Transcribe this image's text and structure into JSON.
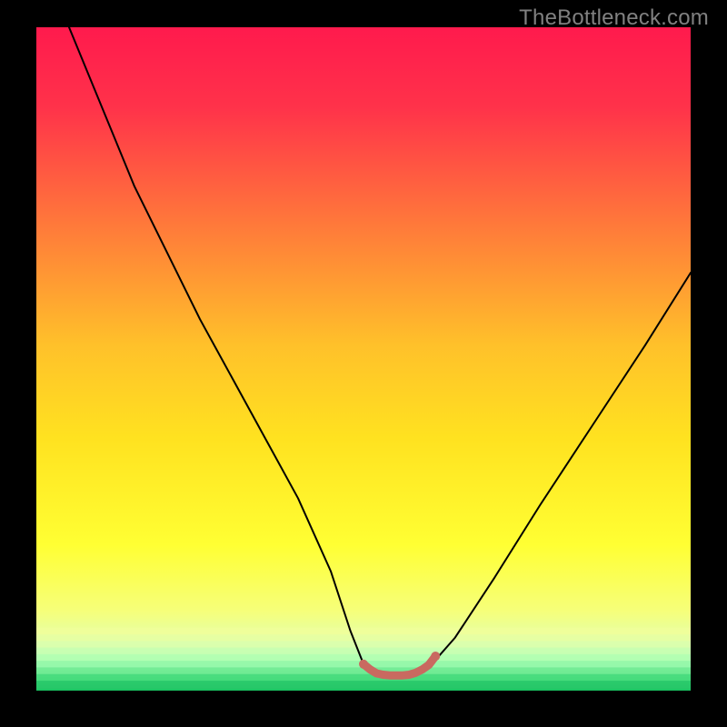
{
  "watermark": "TheBottleneck.com",
  "chart_data": {
    "type": "line",
    "title": "",
    "xlabel": "",
    "ylabel": "",
    "xlim": [
      0,
      100
    ],
    "ylim": [
      0,
      100
    ],
    "grid": false,
    "legend": false,
    "gradient_stops": [
      {
        "offset": 0.0,
        "color": "#ff1a4d"
      },
      {
        "offset": 0.12,
        "color": "#ff324a"
      },
      {
        "offset": 0.3,
        "color": "#ff7a3a"
      },
      {
        "offset": 0.48,
        "color": "#ffc12a"
      },
      {
        "offset": 0.62,
        "color": "#ffe220"
      },
      {
        "offset": 0.78,
        "color": "#ffff33"
      },
      {
        "offset": 0.88,
        "color": "#f6ff7a"
      },
      {
        "offset": 0.93,
        "color": "#e0ffb0"
      },
      {
        "offset": 0.965,
        "color": "#9fffb8"
      },
      {
        "offset": 0.985,
        "color": "#3fe675"
      },
      {
        "offset": 1.0,
        "color": "#18c060"
      }
    ],
    "series": [
      {
        "name": "bottleneck-curve",
        "stroke": "#000000",
        "stroke_width": 2,
        "x": [
          5,
          10,
          15,
          20,
          25,
          30,
          35,
          40,
          45,
          48,
          50,
          52,
          54,
          57,
          60,
          64,
          70,
          77,
          85,
          93,
          100
        ],
        "values": [
          100,
          88,
          76,
          66,
          56,
          47,
          38,
          29,
          18,
          9,
          4,
          2.5,
          2.3,
          2.3,
          3.5,
          8,
          17,
          28,
          40,
          52,
          63
        ]
      },
      {
        "name": "bottleneck-floor-marker",
        "stroke": "#c96a60",
        "stroke_width": 9,
        "x": [
          50,
          51,
          52,
          53,
          54,
          55,
          56,
          57,
          58,
          59,
          60,
          61
        ],
        "values": [
          4.0,
          3.2,
          2.6,
          2.4,
          2.3,
          2.3,
          2.3,
          2.4,
          2.7,
          3.2,
          3.9,
          5.2
        ]
      }
    ],
    "markers": [
      {
        "x": 50,
        "y": 4.0,
        "r": 5,
        "color": "#c96a60"
      },
      {
        "x": 61,
        "y": 5.2,
        "r": 5,
        "color": "#c96a60"
      }
    ]
  }
}
